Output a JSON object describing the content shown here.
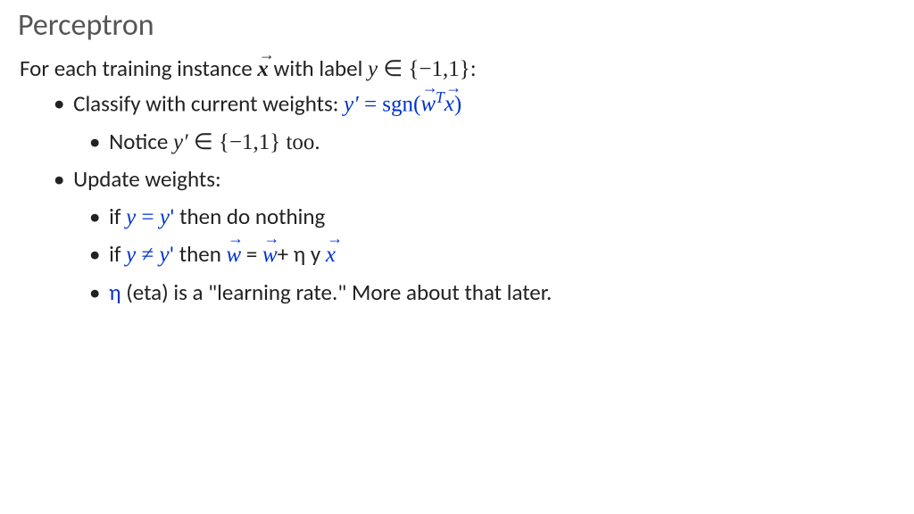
{
  "title": "Perceptron",
  "intro_a": "For each training instance ",
  "intro_x": "x",
  "intro_b": " with label ",
  "intro_y": "y",
  "intro_c": " ∈ {−1,1}:",
  "l1_classify_a": "Classify with current weights: ",
  "l1_classify_yp": "y′",
  "l1_classify_eq": "  =  ",
  "l1_classify_sgn": "sgn(",
  "l1_classify_w": "w",
  "l1_classify_T": "T",
  "l1_classify_x": "x",
  "l1_classify_close": ")",
  "l2_notice_a": "Notice ",
  "l2_notice_yp": "y′",
  "l2_notice_b": " ∈ {−1,1} too.",
  "l1_update": "Update weights:",
  "l2_if1_a": "if ",
  "l2_if1_y": "y",
  "l2_if1_eq": " = ",
  "l2_if1_yp": "y",
  "l2_if1_prime": "'",
  "l2_if1_b": " then do nothing",
  "l2_if2_a": "if ",
  "l2_if2_y": "y",
  "l2_if2_ne": " ≠ ",
  "l2_if2_yp": "y",
  "l2_if2_prime": "'",
  "l2_if2_b": " then ",
  "l2_if2_w1": "w",
  "l2_if2_eq": " = ",
  "l2_if2_w2": "w",
  "l2_if2_plus": "+ η y ",
  "l2_if2_x": "x",
  "l2_eta_a": "η",
  "l2_eta_b": " (eta) is a \"learning rate.\"  More about that later."
}
